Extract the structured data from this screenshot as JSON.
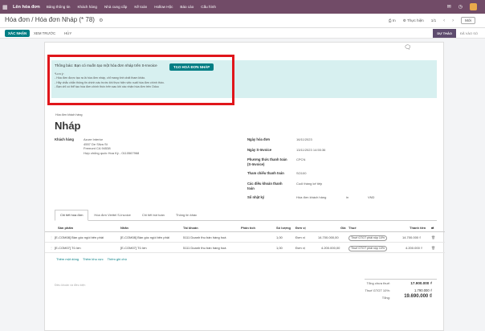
{
  "topbar": {
    "app_title": "Lên hóa đơn",
    "menu": [
      "Bảng thông tin",
      "Khách hàng",
      "Nhà cung cấp",
      "Kế toán",
      "Hollow Hộc",
      "Báo cáo",
      "Cấu hình"
    ]
  },
  "control": {
    "breadcrumb_parent": "Hóa đơn",
    "breadcrumb_sep": "/",
    "breadcrumb_current": "Hóa đơn Nháp (* 78)",
    "print_label": "In",
    "action_label": "Thực hiện",
    "pager": "1/1",
    "new_label": "Mới"
  },
  "actions": {
    "confirm_label": "XÁC NHẬN",
    "preview_label": "XEM TRƯỚC",
    "cancel_label": "HỦY",
    "stage_active": "DỰ THẢO",
    "stage_inactive": "ĐÃ VÀO SỔ"
  },
  "alert": {
    "title": "Thông báo: Bạn có muốn tạo một hóa đơn nháp trên S-Invoice",
    "button_label": "TẠO HOÁ ĐƠN NHÁP",
    "notes": [
      "*Lưu ý:",
      "- Hóa đơn được tạo ra là hóa đơn nháp, chỉ mang tính chất tham khảo.",
      "- Hãy chắc chắn thông tin chính xác trước khi thực hiện việc xuất hóa đơn chính thức.",
      "- Bạn chỉ có thể tạo hóa đơn chính thức trên sau khi xác nhận hóa đơn trên Odoo"
    ]
  },
  "doc": {
    "sub_label": "Hóa đơn khách hàng",
    "title": "Nháp",
    "customer_label": "Khách hàng",
    "customer_lines": [
      "Azure Interior",
      "4557 De Silva St",
      "Fremont CA 94538",
      "Hợp chủng quốc Hoa Kỳ - 0110567968"
    ],
    "invoice_date_label": "Ngày hóa đơn",
    "invoice_date": "16/11/2023",
    "sinvoice_date_label": "Ngày S-Invoice",
    "sinvoice_date": "13/11/2023 14:55:36",
    "payment_method_label": "Phương thức thanh toán (S-Invoice)",
    "payment_method": "CPCN",
    "payment_ref_label": "Tham chiếu thanh toán",
    "payment_ref": "SO100",
    "terms_label": "Các điều khoản thanh toán",
    "terms_value": "Cuối tháng kế tiếp",
    "journal_label": "Sổ nhật ký",
    "journal_value": "Hóa đơn khách hàng",
    "journal_in": "in",
    "currency": "VND"
  },
  "tabs": [
    "Chi tiết hóa đơn",
    "Hóa đơn Viettel S-Invoice",
    "Chi tiết bút toán",
    "Thông tin khác"
  ],
  "grid": {
    "headers": [
      "Sản phẩm",
      "Nhãn",
      "Tài khoản",
      "Phân tích",
      "Số lượng",
      "Đơn vị",
      "Giá",
      "Thuế",
      "Thành tiền"
    ],
    "rows": [
      {
        "product": "[E-COM08] Bàn góc ngồi bên phải",
        "label": "[E-COM08] Bàn góc ngồi bên phải",
        "account": "5111 Doanh thu bán hàng hoá",
        "qty": "1,00",
        "uom": "Đơn vị",
        "price": "14.700.000,00",
        "tax": "Thuế GTGT phải nộp 10%",
        "subtotal": "14.700.000 ₫"
      },
      {
        "product": "[E-COM07] Tủ lớn",
        "label": "[E-COM07] Tủ lớn",
        "account": "5111 Doanh thu bán hàng hoá",
        "qty": "1,00",
        "uom": "Đơn vị",
        "price": "4.200.000,00",
        "tax": "Thuế GTGT phải nộp 10%",
        "subtotal": "4.200.000 ₫"
      }
    ],
    "add_links": [
      "Thêm một dòng",
      "Thêm khu vực",
      "Thêm ghi chú"
    ]
  },
  "footer": {
    "terms_placeholder": "Điều khoản và điều kiện",
    "untaxed_label": "Tổng chưa thuế:",
    "untaxed_value": "17.900.000 ₫",
    "tax_label": "Thuế GTGT 10%:",
    "tax_value": "1.790.000 ₫",
    "total_label": "Tổng:",
    "total_value": "19.690.000 ₫"
  }
}
